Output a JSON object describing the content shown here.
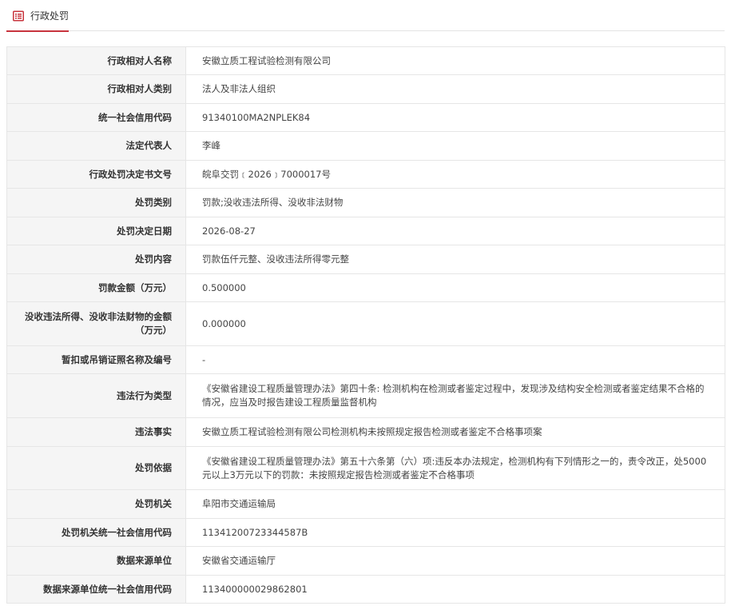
{
  "header": {
    "tab_label": "行政处罚",
    "tab_icon": "document-list-icon",
    "accent_color": "#c8343d"
  },
  "rows": [
    {
      "key": "counterparty_name",
      "label": "行政相对人名称",
      "value": "安徽立质工程试验检测有限公司"
    },
    {
      "key": "counterparty_type",
      "label": "行政相对人类别",
      "value": "法人及非法人组织"
    },
    {
      "key": "credit_code",
      "label": "统一社会信用代码",
      "value": "91340100MA2NPLEK84"
    },
    {
      "key": "legal_rep",
      "label": "法定代表人",
      "value": "李峰"
    },
    {
      "key": "decision_doc_no",
      "label": "行政处罚决定书文号",
      "value": "皖阜交罚﹝2026﹞7000017号"
    },
    {
      "key": "penalty_type",
      "label": "处罚类别",
      "value": "罚款;没收违法所得、没收非法财物"
    },
    {
      "key": "decision_date",
      "label": "处罚决定日期",
      "value": "2026-08-27"
    },
    {
      "key": "penalty_content",
      "label": "处罚内容",
      "value": "罚款伍仟元整、没收违法所得零元整"
    },
    {
      "key": "fine_amount",
      "label": "罚款金额（万元）",
      "value": "0.500000"
    },
    {
      "key": "confiscated_amount",
      "label": "没收违法所得、没收非法财物的金额（万元）",
      "value": "0.000000"
    },
    {
      "key": "license_revoked",
      "label": "暂扣或吊销证照名称及编号",
      "value": "-"
    },
    {
      "key": "violation_type",
      "label": "违法行为类型",
      "value": "《安徽省建设工程质量管理办法》第四十条: 检测机构在检测或者鉴定过程中，发现涉及结构安全检测或者鉴定结果不合格的情况，应当及时报告建设工程质量监督机构"
    },
    {
      "key": "violation_facts",
      "label": "违法事实",
      "value": "安徽立质工程试验检测有限公司检测机构未按照规定报告检测或者鉴定不合格事项案"
    },
    {
      "key": "penalty_basis",
      "label": "处罚依据",
      "value": "《安徽省建设工程质量管理办法》第五十六条第（六）项:违反本办法规定，检测机构有下列情形之一的，责令改正，处5000元以上3万元以下的罚款：未按照规定报告检测或者鉴定不合格事项"
    },
    {
      "key": "penalty_authority",
      "label": "处罚机关",
      "value": "阜阳市交通运输局"
    },
    {
      "key": "authority_credit_code",
      "label": "处罚机关统一社会信用代码",
      "value": "11341200723344587B"
    },
    {
      "key": "data_source",
      "label": "数据来源单位",
      "value": "安徽省交通运输厅"
    },
    {
      "key": "data_source_credit_code",
      "label": "数据来源单位统一社会信用代码",
      "value": "113400000029862801"
    }
  ]
}
